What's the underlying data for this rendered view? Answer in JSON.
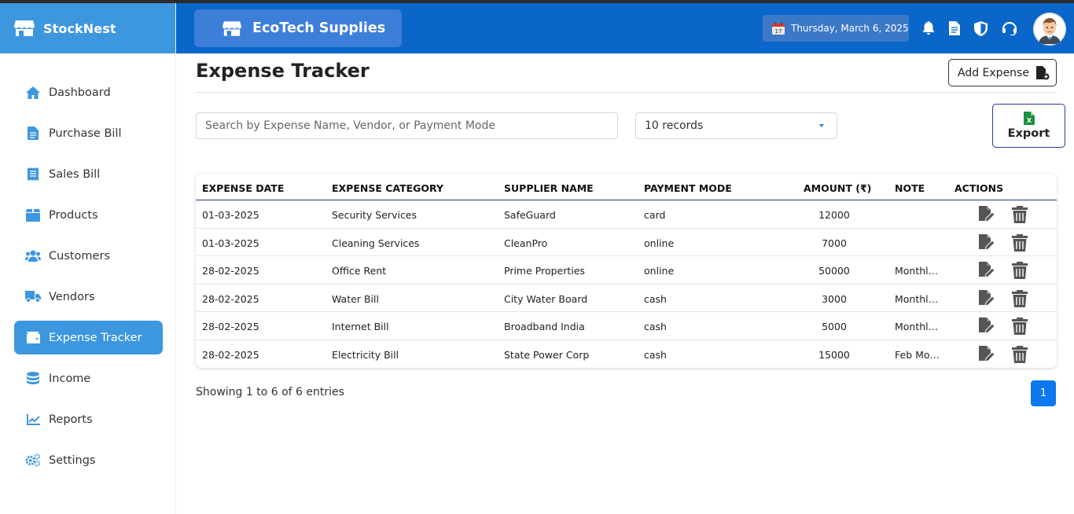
{
  "app": {
    "name": "StockNest",
    "store_name": "EcoTech Supplies",
    "date": "Thursday, March 6, 2025"
  },
  "sidebar": {
    "items": [
      {
        "label": "Dashboard",
        "icon": "home-icon",
        "active": false
      },
      {
        "label": "Purchase Bill",
        "icon": "file-icon",
        "active": false
      },
      {
        "label": "Sales Bill",
        "icon": "receipt-icon",
        "active": false
      },
      {
        "label": "Products",
        "icon": "box-icon",
        "active": false
      },
      {
        "label": "Customers",
        "icon": "users-icon",
        "active": false
      },
      {
        "label": "Vendors",
        "icon": "truck-icon",
        "active": false
      },
      {
        "label": "Expense Tracker",
        "icon": "wallet-icon",
        "active": true
      },
      {
        "label": "Income",
        "icon": "coins-icon",
        "active": false
      },
      {
        "label": "Reports",
        "icon": "chart-icon",
        "active": false
      },
      {
        "label": "Settings",
        "icon": "gears-icon",
        "active": false
      }
    ]
  },
  "page": {
    "title": "Expense Tracker",
    "add_label": "Add Expense",
    "search_placeholder": "Search by Expense Name, Vendor, or Payment Mode",
    "records_selected": "10 records",
    "export_label": "Export",
    "showing": "Showing 1 to 6 of 6 entries",
    "current_page": "1"
  },
  "table": {
    "headers": [
      "EXPENSE DATE",
      "EXPENSE CATEGORY",
      "SUPPLIER NAME",
      "PAYMENT MODE",
      "AMOUNT (₹)",
      "NOTE",
      "ACTIONS"
    ],
    "rows": [
      {
        "date": "01-03-2025",
        "category": "Security Services",
        "supplier": "SafeGuard",
        "mode": "card",
        "amount": "12000",
        "note": ""
      },
      {
        "date": "01-03-2025",
        "category": "Cleaning Services",
        "supplier": "CleanPro",
        "mode": "online",
        "amount": "7000",
        "note": ""
      },
      {
        "date": "28-02-2025",
        "category": "Office Rent",
        "supplier": "Prime Properties",
        "mode": "online",
        "amount": "50000",
        "note": "Monthly…"
      },
      {
        "date": "28-02-2025",
        "category": "Water Bill",
        "supplier": "City Water Board",
        "mode": "cash",
        "amount": "3000",
        "note": "Monthly…"
      },
      {
        "date": "28-02-2025",
        "category": "Internet Bill",
        "supplier": "Broadband India",
        "mode": "cash",
        "amount": "5000",
        "note": "Monthly…"
      },
      {
        "date": "28-02-2025",
        "category": "Electricity Bill",
        "supplier": "State Power Corp",
        "mode": "cash",
        "amount": "15000",
        "note": "Feb Mo…"
      }
    ]
  },
  "colors": {
    "sidebar_brand": "#3d97df",
    "header": "#0a66c8",
    "active_nav": "#3d97df",
    "pagination": "#0d78f0",
    "icon_gray": "#555555"
  }
}
